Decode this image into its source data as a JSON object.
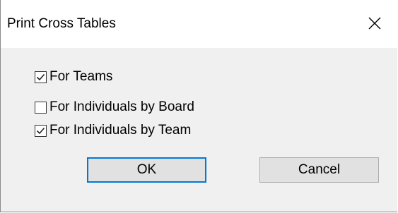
{
  "dialog": {
    "title": "Print Cross Tables",
    "close_icon": "close-icon"
  },
  "options": [
    {
      "label": "For Teams",
      "checked": true
    },
    {
      "label": "For Individuals by Board",
      "checked": false
    },
    {
      "label": "For Individuals by Team",
      "checked": true
    }
  ],
  "buttons": {
    "ok_label": "OK",
    "cancel_label": "Cancel"
  },
  "colors": {
    "default_button_border": "#0078d7",
    "dialog_background": "#f0f0f0"
  }
}
